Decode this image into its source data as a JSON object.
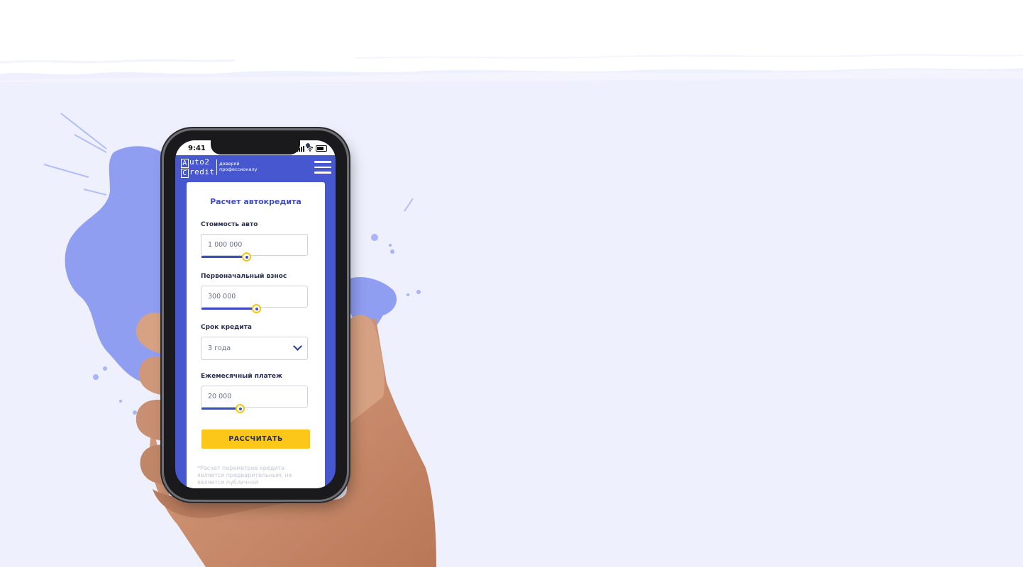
{
  "status_bar": {
    "time": "9:41"
  },
  "header": {
    "logo_line1": "uto2",
    "logo_line2": "redit",
    "logo_letter1": "A",
    "logo_letter2": "C",
    "tagline_line1": "доверяй",
    "tagline_line2": "профессионалу"
  },
  "form": {
    "title": "Расчет автокредита",
    "car_price": {
      "label": "Стоимость авто",
      "value": "1 000 000",
      "slider_fraction": 0.42
    },
    "down_payment": {
      "label": "Первоначальный взнос",
      "value": "300 000",
      "slider_fraction": 0.51
    },
    "term": {
      "label": "Срок кредита",
      "value": "3 года"
    },
    "monthly_payment": {
      "label": "Ежемесячный платеж",
      "value": "20 000",
      "slider_fraction": 0.36
    },
    "submit_label": "РАССЧИТАТЬ",
    "disclaimer": "*Расчет параметров кредита является предварительным, не является публичной"
  },
  "colors": {
    "brand_blue": "#4657cf",
    "accent_yellow": "#fcc718",
    "background_lavender": "#eef0fd"
  }
}
